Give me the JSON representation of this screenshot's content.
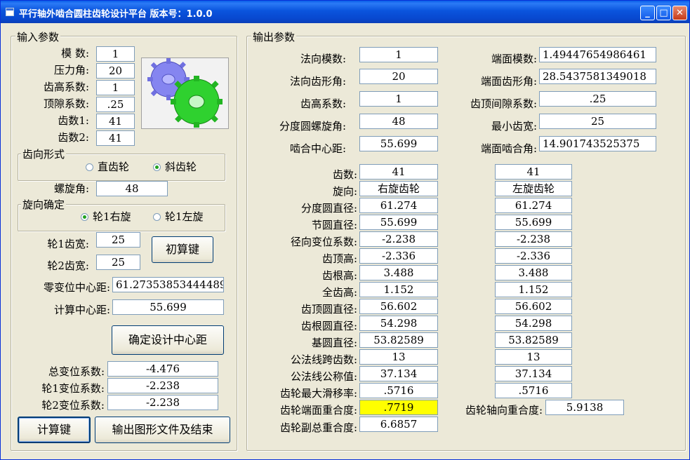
{
  "window": {
    "title": "平行轴外啮合圆柱齿轮设计平台  版本号：1.0.0",
    "min": "_",
    "max": "□",
    "close": "✕"
  },
  "input": {
    "group_label": "输入参数",
    "module": {
      "label": "模  数:",
      "value": "1"
    },
    "pressure_angle": {
      "label": "压力角:",
      "value": "20"
    },
    "addendum_coef": {
      "label": "齿高系数:",
      "value": "1"
    },
    "clearance_coef": {
      "label": "顶隙系数:",
      "value": ".25"
    },
    "z1": {
      "label": "齿数1:",
      "value": "41"
    },
    "z2": {
      "label": "齿数2:",
      "value": "41"
    },
    "tooth_form": {
      "label": "齿向形式",
      "spur": "直齿轮",
      "helical": "斜齿轮",
      "selected": "helical"
    },
    "helix_angle": {
      "label": "螺旋角:",
      "value": "48"
    },
    "hand": {
      "label": "旋向确定",
      "right": "轮1右旋",
      "left": "轮1左旋",
      "selected": "right"
    },
    "width1": {
      "label": "轮1齿宽:",
      "value": "25"
    },
    "width2": {
      "label": "轮2齿宽:",
      "value": "25"
    },
    "initial_button": "初算键",
    "zero_shift_center": {
      "label": "零变位中心距:",
      "value": "61.27353853444489"
    },
    "calc_center": {
      "label": "计算中心距:",
      "value": "55.699"
    },
    "confirm_center_button": "确定设计中心距",
    "total_shift": {
      "label": "总变位系数:",
      "value": "-4.476"
    },
    "shift1": {
      "label": "轮1变位系数:",
      "value": "-2.238"
    },
    "shift2": {
      "label": "轮2变位系数:",
      "value": "-2.238"
    },
    "calc_button": "计算键",
    "export_button": "输出图形文件及结束"
  },
  "output": {
    "group_label": "输出参数",
    "normal_module": {
      "label": "法向模数:",
      "value": "1"
    },
    "transverse_module": {
      "label": "端面模数:",
      "value": "1.49447654986461"
    },
    "normal_pressure_angle": {
      "label": "法向齿形角:",
      "value": "20"
    },
    "transverse_pressure_angle": {
      "label": "端面齿形角:",
      "value": "28.5437581349018"
    },
    "addendum_coef": {
      "label": "齿高系数:",
      "value": "1"
    },
    "clearance_coef": {
      "label": "齿顶间隙系数:",
      "value": ".25"
    },
    "helix_angle": {
      "label": "分度圆螺旋角:",
      "value": "48"
    },
    "min_width": {
      "label": "最小齿宽:",
      "value": "25"
    },
    "center_distance": {
      "label": "啮合中心距:",
      "value": "55.699"
    },
    "transverse_working_angle": {
      "label": "端面啮合角:",
      "value": "14.901743525375"
    },
    "table": {
      "labels": [
        "齿数:",
        "旋向:",
        "分度圆直径:",
        "节圆直径:",
        "径向变位系数:",
        "齿顶高:",
        "齿根高:",
        "全齿高:",
        "齿顶圆直径:",
        "齿根圆直径:",
        "基圆直径:",
        "公法线跨齿数:",
        "公法线公称值:",
        "齿轮最大滑移率:"
      ],
      "gear1": [
        "41",
        "右旋齿轮",
        "61.274",
        "55.699",
        "-2.238",
        "-2.336",
        "3.488",
        "1.152",
        "56.602",
        "54.298",
        "53.82589",
        "13",
        "37.134",
        ".5716"
      ],
      "gear2": [
        "41",
        "左旋齿轮",
        "61.274",
        "55.699",
        "-2.238",
        "-2.336",
        "3.488",
        "1.152",
        "56.602",
        "54.298",
        "53.82589",
        "13",
        "37.134",
        ".5716"
      ]
    },
    "transverse_contact": {
      "label": "齿轮端面重合度:",
      "value": ".7719"
    },
    "axial_contact": {
      "label": "齿轮轴向重合度:",
      "value": "5.9138"
    },
    "total_contact": {
      "label": "齿轮副总重合度:",
      "value": "6.6857"
    }
  },
  "colors": {
    "title_bar": "#0a54dd",
    "highlight": "#ffff00",
    "gear1": "#8585f0",
    "gear2": "#2fd12f"
  }
}
